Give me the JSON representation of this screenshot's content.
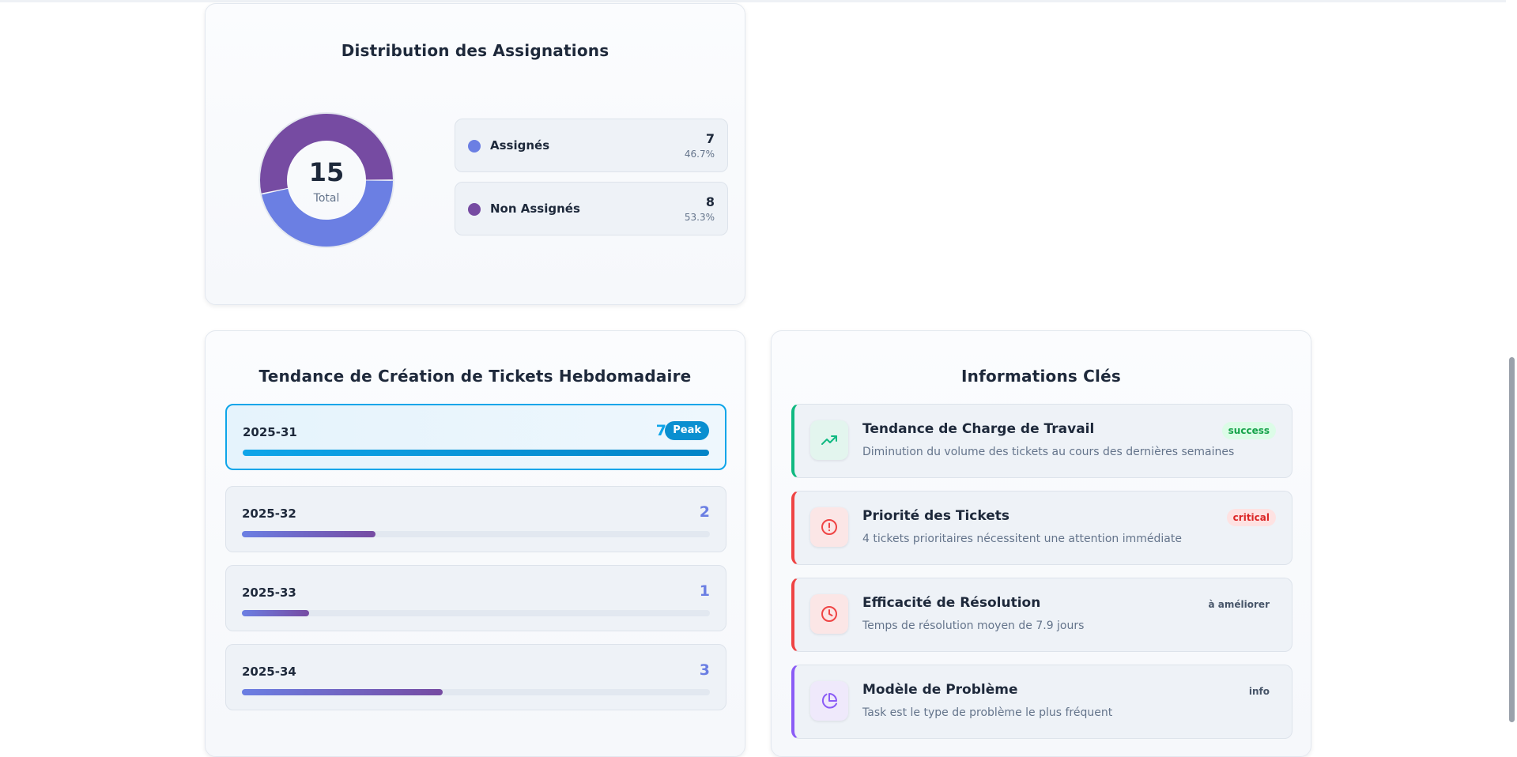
{
  "distribution": {
    "title": "Distribution des Assignations",
    "total": "15",
    "total_label": "Total",
    "items": [
      {
        "name": "Assignés",
        "value": "7",
        "percent": "46.7%",
        "color": "#6b7fe3"
      },
      {
        "name": "Non Assignés",
        "value": "8",
        "percent": "53.3%",
        "color": "#764ba2"
      }
    ]
  },
  "trend": {
    "title": "Tendance de Création de Tickets Hebdomadaire",
    "peak_label": "Peak",
    "weeks": [
      {
        "label": "2025-31",
        "count": "7",
        "fraction": 1.0,
        "peak": true
      },
      {
        "label": "2025-32",
        "count": "2",
        "fraction": 0.2857
      },
      {
        "label": "2025-33",
        "count": "1",
        "fraction": 0.1429
      },
      {
        "label": "2025-34",
        "count": "3",
        "fraction": 0.4286
      }
    ]
  },
  "insights": {
    "title": "Informations Clés",
    "items": [
      {
        "title": "Tendance de Charge de Travail",
        "description": "Diminution du volume des tickets au cours des dernières semaines",
        "badge": "success",
        "accent": "#10b981",
        "icon": "trending-up-icon"
      },
      {
        "title": "Priorité des Tickets",
        "description": "4 tickets prioritaires nécessitent une attention immédiate",
        "badge": "critical",
        "accent": "#ef4444",
        "icon": "alert-circle-icon"
      },
      {
        "title": "Efficacité de Résolution",
        "description": "Temps de résolution moyen de 7.9 jours",
        "badge": "à améliorer",
        "accent": "#ef4444",
        "icon": "clock-icon"
      },
      {
        "title": "Modèle de Problème",
        "description": "Task est le type de problème le plus fréquent",
        "badge": "info",
        "accent": "#8b5cf6",
        "icon": "pie-chart-icon"
      }
    ]
  }
}
